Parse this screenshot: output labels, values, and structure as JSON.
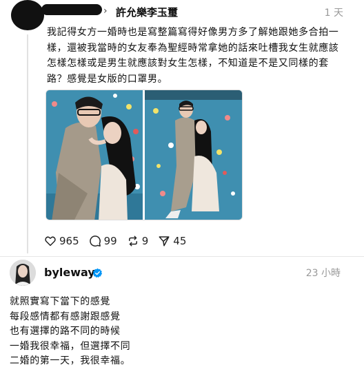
{
  "reply_post": {
    "reply_to_user": "許允樂李玉璽",
    "time": "1 天",
    "text": "我記得女方一婚時也是寫整篇寫得好像男方多了解她跟她多合拍一樣，還被我當時的女友奉為聖經時常拿她的話來吐槽我女生就應該怎樣怎樣或是男生就應該對女生怎樣，不知道是不是又同樣的套路？感覺是女版的口罩男。",
    "stats": {
      "likes": "965",
      "comments": "99",
      "reposts": "9",
      "shares": "45"
    }
  },
  "main_post": {
    "username": "byleway",
    "time": "23 小時",
    "lines": [
      "就照實寫下當下的感覺",
      "每段感情都有感謝跟感覺",
      "也有選擇的路不同的時候",
      "一婚我很幸福，但選擇不同",
      "二婚的第一天，我很幸福。"
    ]
  },
  "colors": {
    "verified_blue": "#0095f6",
    "secondary_text": "#999999",
    "climbing_wall": "#3f8fb0"
  }
}
